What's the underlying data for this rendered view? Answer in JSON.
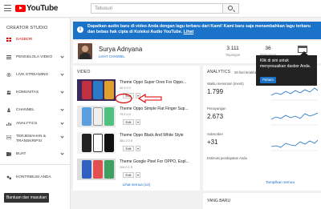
{
  "header": {
    "logo_text": "YouTube",
    "search_placeholder": "Telusuri"
  },
  "sidebar": {
    "title": "CREATOR STUDIO",
    "items": [
      {
        "label": "DASBOR",
        "icon": "dashboard-icon",
        "active": true
      },
      {
        "label": "PENGELOLA VIDEO",
        "icon": "video-manager-icon"
      },
      {
        "label": "LIVE STREAMING",
        "icon": "live-icon"
      },
      {
        "label": "KOMUNITAS",
        "icon": "community-icon"
      },
      {
        "label": "CHANNEL",
        "icon": "channel-icon"
      },
      {
        "label": "ANALYTICS",
        "icon": "analytics-icon"
      },
      {
        "label": "TERJEMAHAN & TRANSKRIPSI",
        "icon": "translate-icon"
      },
      {
        "label": "BUAT",
        "icon": "create-icon"
      },
      {
        "label": "KONTRIBUSI ANDA",
        "icon": "contributions-icon"
      }
    ],
    "help_button": "Bantuan dan masukan",
    "accent_color": "#cc0000"
  },
  "banner": {
    "text": "Dapatkan audio baru di video Anda dengan lagu terbaru dari Kami! Kami baru saja menambahkan lagu terbaru dan bebas hak cipta di Koleksi Audio YouTube.",
    "link": "Lihat",
    "color": "#1a73c9"
  },
  "channel": {
    "name": "Surya Adnyana",
    "link": "LIHAT CHANNEL",
    "stats": [
      {
        "value": "3.111",
        "caption": "Tayangan"
      },
      {
        "value": "36",
        "caption": "Pelanggan"
      }
    ]
  },
  "tooltip": {
    "text": "Klik di sini untuk menyesuaikan dasbor Anda.",
    "button": "Paham"
  },
  "videos": {
    "title": "VIDEO",
    "items": [
      {
        "title": "Theme Oppo Super Oreo For Oppo...",
        "meta": "42   0   0   0",
        "edit": "Edit"
      },
      {
        "title": "Theme Oppo Simple Flat Finger Sup...",
        "meta": "79   0   0   0",
        "edit": "Edit"
      },
      {
        "title": "Theme Oppo Black And White Style",
        "meta": "381   2   0   0",
        "edit": "Edit"
      },
      {
        "title": "Theme Google Pixel For OPPO, Espl...",
        "meta": "104   0   1   0",
        "edit": "Edit"
      }
    ],
    "see_all": "Lihat semua (14)"
  },
  "analytics": {
    "title": "ANALYTICS",
    "subtitle": "28 hari terakhir",
    "metrics": [
      {
        "label": "Waktu menonton (menit)",
        "value": "1.799"
      },
      {
        "label": "Penayangan",
        "value": "2.673"
      },
      {
        "label": "Subscriber",
        "value": "+31"
      },
      {
        "label": "Estimasi pendapatan Anda",
        "value": ""
      }
    ],
    "link": "Tampilkan semua"
  },
  "bottom_card": {
    "title": "YANG BARU"
  }
}
